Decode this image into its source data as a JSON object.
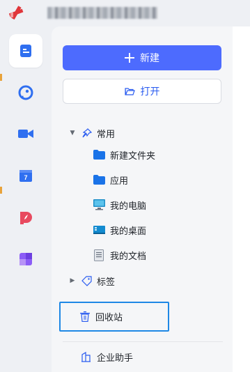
{
  "app": {
    "title_obscured": true
  },
  "actions": {
    "new_label": "新建",
    "open_label": "打开"
  },
  "tree": {
    "common": "常用",
    "new_folder": "新建文件夹",
    "apps": "应用",
    "my_computer": "我的电脑",
    "my_desktop": "我的桌面",
    "my_documents": "我的文档",
    "tags": "标签",
    "recycle": "回收站",
    "enterprise": "企业助手"
  },
  "colors": {
    "accent": "#4d6bfe",
    "focus_border": "#1e88e5",
    "folder": "#1a73e8"
  }
}
